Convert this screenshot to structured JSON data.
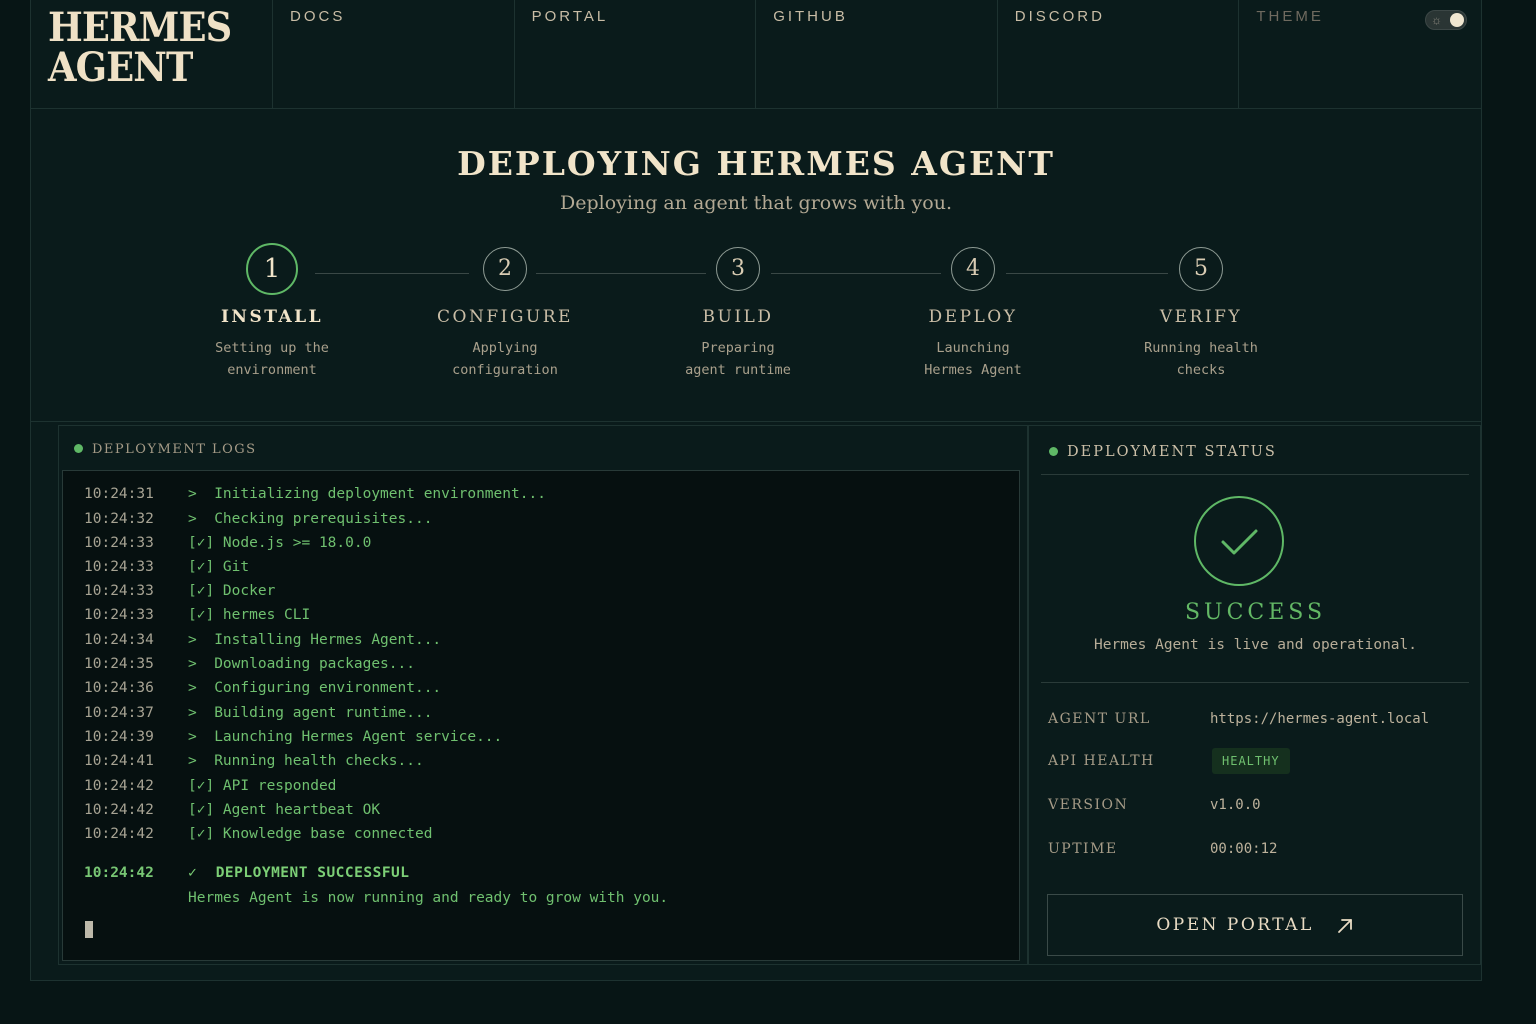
{
  "brand": {
    "line1": "HERMES",
    "line2": "AGENT"
  },
  "nav": {
    "items": [
      "DOCS",
      "PORTAL",
      "GITHUB",
      "DISCORD"
    ],
    "theme_label": "THEME"
  },
  "hero": {
    "title": "DEPLOYING HERMES AGENT",
    "subtitle": "Deploying an agent that grows with you."
  },
  "steps": [
    {
      "num": "1",
      "label": "INSTALL",
      "desc1": "Setting up the",
      "desc2": "environment",
      "active": true
    },
    {
      "num": "2",
      "label": "CONFIGURE",
      "desc1": "Applying",
      "desc2": "configuration"
    },
    {
      "num": "3",
      "label": "BUILD",
      "desc1": "Preparing",
      "desc2": "agent runtime"
    },
    {
      "num": "4",
      "label": "DEPLOY",
      "desc1": "Launching",
      "desc2": "Hermes Agent"
    },
    {
      "num": "5",
      "label": "VERIFY",
      "desc1": "Running health",
      "desc2": "checks"
    }
  ],
  "logs": {
    "title": "DEPLOYMENT LOGS",
    "lines": [
      {
        "ts": "10:24:31",
        "msg": ">  Initializing deployment environment..."
      },
      {
        "ts": "10:24:32",
        "msg": ">  Checking prerequisites..."
      },
      {
        "ts": "10:24:33",
        "msg": "[✓] Node.js >= 18.0.0"
      },
      {
        "ts": "10:24:33",
        "msg": "[✓] Git"
      },
      {
        "ts": "10:24:33",
        "msg": "[✓] Docker"
      },
      {
        "ts": "10:24:33",
        "msg": "[✓] hermes CLI"
      },
      {
        "ts": "10:24:34",
        "msg": ">  Installing Hermes Agent..."
      },
      {
        "ts": "10:24:35",
        "msg": ">  Downloading packages..."
      },
      {
        "ts": "10:24:36",
        "msg": ">  Configuring environment..."
      },
      {
        "ts": "10:24:37",
        "msg": ">  Building agent runtime..."
      },
      {
        "ts": "10:24:39",
        "msg": ">  Launching Hermes Agent service..."
      },
      {
        "ts": "10:24:41",
        "msg": ">  Running health checks..."
      },
      {
        "ts": "10:24:42",
        "msg": "[✓] API responded"
      },
      {
        "ts": "10:24:42",
        "msg": "[✓] Agent heartbeat OK"
      },
      {
        "ts": "10:24:42",
        "msg": "[✓] Knowledge base connected"
      }
    ],
    "final": {
      "ts": "10:24:42",
      "msg": "✓  DEPLOYMENT SUCCESSFUL"
    },
    "tail": "Hermes Agent is now running and ready to grow with you."
  },
  "status": {
    "title": "DEPLOYMENT STATUS",
    "state": "SUCCESS",
    "message": "Hermes Agent is live and operational.",
    "agent_url_label": "AGENT URL",
    "agent_url": "https://hermes-agent.local",
    "api_health_label": "API HEALTH",
    "api_health": "HEALTHY",
    "version_label": "VERSION",
    "version": "v1.0.0",
    "uptime_label": "UPTIME",
    "uptime": "00:00:12",
    "open_portal": "OPEN PORTAL"
  },
  "icons": [
    "sun-icon",
    "check-icon",
    "arrow-up-right-icon"
  ],
  "colors": {
    "accent": "#5fb866",
    "background": "#071515",
    "text": "#e9dcc4"
  }
}
